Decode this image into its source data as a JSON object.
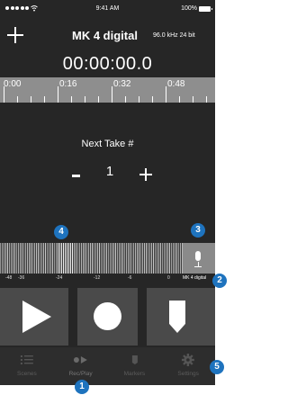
{
  "status_bar": {
    "time": "9:41 AM",
    "battery": "100%"
  },
  "header": {
    "add_icon": "plus-icon",
    "device_title": "MK 4 digital",
    "sample_rate": "96.0 kHz 24 bit"
  },
  "timecode": "00:00:00.0",
  "timeline": {
    "labels": [
      "0:00",
      "0:16",
      "0:32",
      "0:48"
    ]
  },
  "take": {
    "label": "Next Take #",
    "number": "1"
  },
  "meter": {
    "scale": [
      "-48",
      "-36",
      "-24",
      "-12",
      "-6",
      "0"
    ],
    "device_name": "MK 4 digital",
    "mic_icon": "microphone-icon"
  },
  "transport": {
    "play_icon": "play-icon",
    "record_icon": "record-icon",
    "marker_icon": "marker-icon"
  },
  "tabs": [
    {
      "label": "Scenes",
      "icon": "list-icon"
    },
    {
      "label": "Rec/Play",
      "icon": "rec-play-icon"
    },
    {
      "label": "Markers",
      "icon": "marker-icon"
    },
    {
      "label": "Settings",
      "icon": "gear-icon"
    }
  ],
  "callouts": {
    "rec_play_tab": "1",
    "device_name": "2",
    "input_select": "3",
    "level_meter": "4",
    "settings_tab": "5"
  },
  "colors": {
    "background": "#262626",
    "ruler": "#8e8e8e",
    "button": "#4a4a4a",
    "callout": "#1e73be"
  }
}
